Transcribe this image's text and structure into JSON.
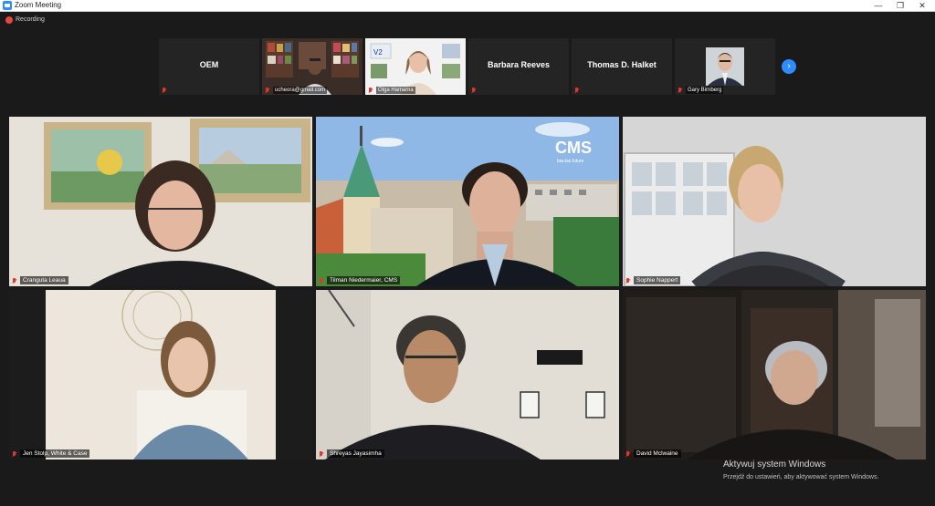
{
  "window": {
    "title": "Zoom Meeting",
    "minimize": "—",
    "restore": "❐",
    "close": "✕"
  },
  "recording": {
    "label": "Recording",
    "color": "#e6483d"
  },
  "strip": {
    "thumbs": [
      {
        "name": "OEM",
        "label": "",
        "video": false
      },
      {
        "name": "",
        "label": "ucheora@gmail.com",
        "video": true
      },
      {
        "name": "",
        "label": "Olga Hamama",
        "video": true
      },
      {
        "name": "Barbara Reeves",
        "label": "",
        "video": false
      },
      {
        "name": "Thomas D. Halket",
        "label": "",
        "video": false
      },
      {
        "name": "",
        "label": "Gary Birnberg",
        "video": true
      }
    ],
    "next_icon": "›"
  },
  "tiles": [
    {
      "label": "Cranguta Leaua"
    },
    {
      "label": "Tilman Niedermaier, CMS",
      "logo": "CMS",
      "tagline": "law.tax.future"
    },
    {
      "label": "Sophie Nappert"
    },
    {
      "label": "Jen Stolp, White & Case"
    },
    {
      "label": "Shreyas Jayasimha"
    },
    {
      "label": "David Mclwaine"
    }
  ],
  "watermark": {
    "line1": "Aktywuj system Windows",
    "line2": "Przejdź do ustawień, aby aktywować system Windows."
  },
  "colors": {
    "accent": "#2d8cff",
    "muted": "#e0362c",
    "background": "#1a1a1a"
  }
}
